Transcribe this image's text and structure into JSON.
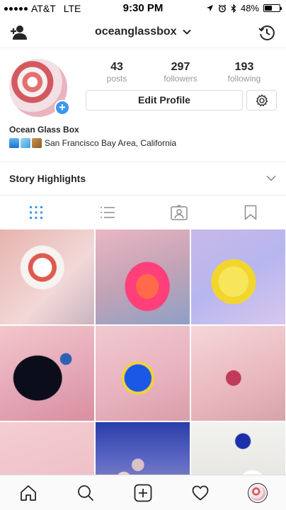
{
  "status_bar": {
    "carrier": "AT&T",
    "network": "LTE",
    "time": "9:30 PM",
    "battery_percent": "48%",
    "battery_level": 0.48
  },
  "header": {
    "username": "oceanglassbox",
    "icons": [
      "add-person-icon",
      "chevron-down-icon",
      "history-icon"
    ]
  },
  "profile": {
    "stats": [
      {
        "value": "43",
        "label": "posts"
      },
      {
        "value": "297",
        "label": "followers"
      },
      {
        "value": "193",
        "label": "following"
      }
    ],
    "edit_profile_label": "Edit Profile",
    "display_name": "Ocean Glass Box",
    "bio_location": "San Francisco Bay Area, California"
  },
  "highlights": {
    "label": "Story Highlights"
  },
  "view_tabs": [
    "grid-icon",
    "list-icon",
    "tagged-icon",
    "saved-icon"
  ],
  "bottom_nav": [
    "home-icon",
    "search-icon",
    "new-post-icon",
    "activity-icon",
    "profile-icon"
  ],
  "colors": {
    "accent_blue": "#3897f0",
    "text": "#262626",
    "muted": "#999999",
    "border": "#dbdbdb"
  }
}
